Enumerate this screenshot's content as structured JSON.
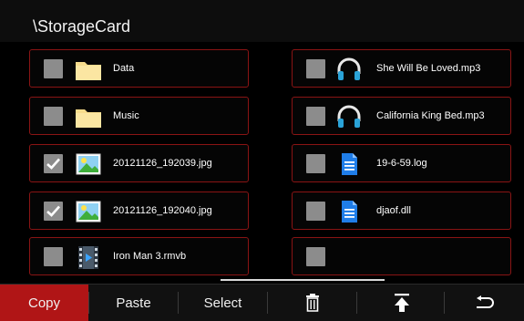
{
  "header": {
    "path": "\\StorageCard"
  },
  "files": {
    "left": [
      {
        "name": "Data",
        "icon": "folder-icon",
        "checked": false
      },
      {
        "name": "Music",
        "icon": "folder-icon",
        "checked": false
      },
      {
        "name": "20121126_192039.jpg",
        "icon": "image-file-icon",
        "checked": true
      },
      {
        "name": "20121126_192040.jpg",
        "icon": "image-file-icon",
        "checked": true
      },
      {
        "name": "Iron Man 3.rmvb",
        "icon": "video-file-icon",
        "checked": false
      }
    ],
    "right": [
      {
        "name": "She Will Be Loved.mp3",
        "icon": "headphones-icon",
        "checked": false
      },
      {
        "name": "California King Bed.mp3",
        "icon": "headphones-icon",
        "checked": false
      },
      {
        "name": "19-6-59.log",
        "icon": "document-icon",
        "checked": false
      },
      {
        "name": "djaof.dll",
        "icon": "document-icon",
        "checked": false
      },
      {
        "name": "",
        "icon": "",
        "checked": false
      }
    ]
  },
  "toolbar": {
    "copy_label": "Copy",
    "paste_label": "Paste",
    "select_label": "Select",
    "delete_icon": "trash-icon",
    "top_icon": "move-to-top-icon",
    "back_icon": "back-arrow-icon"
  },
  "colors": {
    "accent": "#b01516",
    "item_border": "#8a1414",
    "checkbox": "#8c8c8c",
    "folder": "#f7dc8c",
    "doc": "#1f7de8"
  }
}
